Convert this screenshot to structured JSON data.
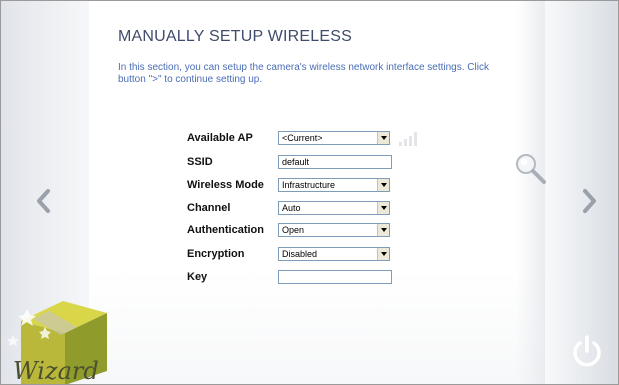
{
  "page": {
    "title": "MANUALLY SETUP WIRELESS",
    "description": "In this section, you can setup the camera's wireless network interface settings. Click button \">\" to continue setting up."
  },
  "form": {
    "available_ap": {
      "label": "Available AP",
      "value": "<Current>"
    },
    "ssid": {
      "label": "SSID",
      "value": "default"
    },
    "wireless_mode": {
      "label": "Wireless Mode",
      "value": "Infrastructure"
    },
    "channel": {
      "label": "Channel",
      "value": "Auto"
    },
    "authentication": {
      "label": "Authentication",
      "value": "Open"
    },
    "encryption": {
      "label": "Encryption",
      "value": "Disabled"
    },
    "key": {
      "label": "Key",
      "value": ""
    }
  },
  "signal_strength": 0,
  "nav": {
    "prev_icon": "chevron-left-icon",
    "next_icon": "chevron-right-icon",
    "search_icon": "magnifier-icon",
    "power_icon": "power-icon"
  },
  "brand": {
    "logo_text": "Wizard"
  },
  "colors": {
    "title": "#3f4c6b",
    "description": "#4a6eb5",
    "arrow": "#9aa1ab"
  }
}
